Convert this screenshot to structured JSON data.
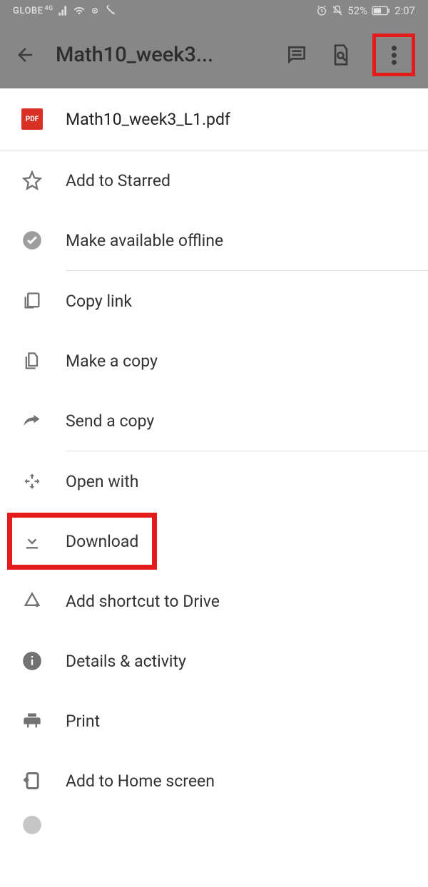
{
  "status_bar": {
    "carrier": "GLOBE",
    "network_type": "4G",
    "battery": "52%",
    "time": "2:07"
  },
  "app_bar": {
    "title": "Math10_week3...",
    "back_label": "Back",
    "comment_label": "Comments",
    "find_label": "Find in document",
    "more_label": "More options"
  },
  "file": {
    "name": "Math10_week3_L1.pdf",
    "type_badge": "PDF"
  },
  "menu": {
    "add_starred": "Add to Starred",
    "available_offline": "Make available offline",
    "copy_link": "Copy link",
    "make_copy": "Make a copy",
    "send_copy": "Send a copy",
    "open_with": "Open with",
    "download": "Download",
    "add_shortcut": "Add shortcut to Drive",
    "details": "Details & activity",
    "print": "Print",
    "add_home": "Add to Home screen"
  }
}
